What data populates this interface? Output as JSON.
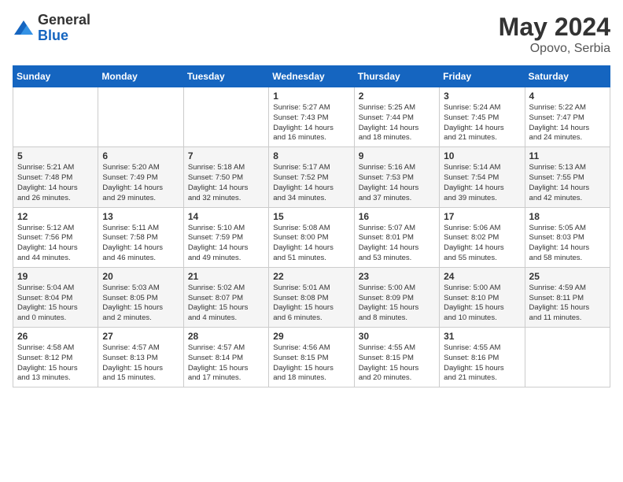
{
  "header": {
    "logo_general": "General",
    "logo_blue": "Blue",
    "title": "May 2024",
    "location": "Opovo, Serbia"
  },
  "weekdays": [
    "Sunday",
    "Monday",
    "Tuesday",
    "Wednesday",
    "Thursday",
    "Friday",
    "Saturday"
  ],
  "weeks": [
    [
      {
        "day": "",
        "info": ""
      },
      {
        "day": "",
        "info": ""
      },
      {
        "day": "",
        "info": ""
      },
      {
        "day": "1",
        "info": "Sunrise: 5:27 AM\nSunset: 7:43 PM\nDaylight: 14 hours\nand 16 minutes."
      },
      {
        "day": "2",
        "info": "Sunrise: 5:25 AM\nSunset: 7:44 PM\nDaylight: 14 hours\nand 18 minutes."
      },
      {
        "day": "3",
        "info": "Sunrise: 5:24 AM\nSunset: 7:45 PM\nDaylight: 14 hours\nand 21 minutes."
      },
      {
        "day": "4",
        "info": "Sunrise: 5:22 AM\nSunset: 7:47 PM\nDaylight: 14 hours\nand 24 minutes."
      }
    ],
    [
      {
        "day": "5",
        "info": "Sunrise: 5:21 AM\nSunset: 7:48 PM\nDaylight: 14 hours\nand 26 minutes."
      },
      {
        "day": "6",
        "info": "Sunrise: 5:20 AM\nSunset: 7:49 PM\nDaylight: 14 hours\nand 29 minutes."
      },
      {
        "day": "7",
        "info": "Sunrise: 5:18 AM\nSunset: 7:50 PM\nDaylight: 14 hours\nand 32 minutes."
      },
      {
        "day": "8",
        "info": "Sunrise: 5:17 AM\nSunset: 7:52 PM\nDaylight: 14 hours\nand 34 minutes."
      },
      {
        "day": "9",
        "info": "Sunrise: 5:16 AM\nSunset: 7:53 PM\nDaylight: 14 hours\nand 37 minutes."
      },
      {
        "day": "10",
        "info": "Sunrise: 5:14 AM\nSunset: 7:54 PM\nDaylight: 14 hours\nand 39 minutes."
      },
      {
        "day": "11",
        "info": "Sunrise: 5:13 AM\nSunset: 7:55 PM\nDaylight: 14 hours\nand 42 minutes."
      }
    ],
    [
      {
        "day": "12",
        "info": "Sunrise: 5:12 AM\nSunset: 7:56 PM\nDaylight: 14 hours\nand 44 minutes."
      },
      {
        "day": "13",
        "info": "Sunrise: 5:11 AM\nSunset: 7:58 PM\nDaylight: 14 hours\nand 46 minutes."
      },
      {
        "day": "14",
        "info": "Sunrise: 5:10 AM\nSunset: 7:59 PM\nDaylight: 14 hours\nand 49 minutes."
      },
      {
        "day": "15",
        "info": "Sunrise: 5:08 AM\nSunset: 8:00 PM\nDaylight: 14 hours\nand 51 minutes."
      },
      {
        "day": "16",
        "info": "Sunrise: 5:07 AM\nSunset: 8:01 PM\nDaylight: 14 hours\nand 53 minutes."
      },
      {
        "day": "17",
        "info": "Sunrise: 5:06 AM\nSunset: 8:02 PM\nDaylight: 14 hours\nand 55 minutes."
      },
      {
        "day": "18",
        "info": "Sunrise: 5:05 AM\nSunset: 8:03 PM\nDaylight: 14 hours\nand 58 minutes."
      }
    ],
    [
      {
        "day": "19",
        "info": "Sunrise: 5:04 AM\nSunset: 8:04 PM\nDaylight: 15 hours\nand 0 minutes."
      },
      {
        "day": "20",
        "info": "Sunrise: 5:03 AM\nSunset: 8:05 PM\nDaylight: 15 hours\nand 2 minutes."
      },
      {
        "day": "21",
        "info": "Sunrise: 5:02 AM\nSunset: 8:07 PM\nDaylight: 15 hours\nand 4 minutes."
      },
      {
        "day": "22",
        "info": "Sunrise: 5:01 AM\nSunset: 8:08 PM\nDaylight: 15 hours\nand 6 minutes."
      },
      {
        "day": "23",
        "info": "Sunrise: 5:00 AM\nSunset: 8:09 PM\nDaylight: 15 hours\nand 8 minutes."
      },
      {
        "day": "24",
        "info": "Sunrise: 5:00 AM\nSunset: 8:10 PM\nDaylight: 15 hours\nand 10 minutes."
      },
      {
        "day": "25",
        "info": "Sunrise: 4:59 AM\nSunset: 8:11 PM\nDaylight: 15 hours\nand 11 minutes."
      }
    ],
    [
      {
        "day": "26",
        "info": "Sunrise: 4:58 AM\nSunset: 8:12 PM\nDaylight: 15 hours\nand 13 minutes."
      },
      {
        "day": "27",
        "info": "Sunrise: 4:57 AM\nSunset: 8:13 PM\nDaylight: 15 hours\nand 15 minutes."
      },
      {
        "day": "28",
        "info": "Sunrise: 4:57 AM\nSunset: 8:14 PM\nDaylight: 15 hours\nand 17 minutes."
      },
      {
        "day": "29",
        "info": "Sunrise: 4:56 AM\nSunset: 8:15 PM\nDaylight: 15 hours\nand 18 minutes."
      },
      {
        "day": "30",
        "info": "Sunrise: 4:55 AM\nSunset: 8:15 PM\nDaylight: 15 hours\nand 20 minutes."
      },
      {
        "day": "31",
        "info": "Sunrise: 4:55 AM\nSunset: 8:16 PM\nDaylight: 15 hours\nand 21 minutes."
      },
      {
        "day": "",
        "info": ""
      }
    ]
  ]
}
